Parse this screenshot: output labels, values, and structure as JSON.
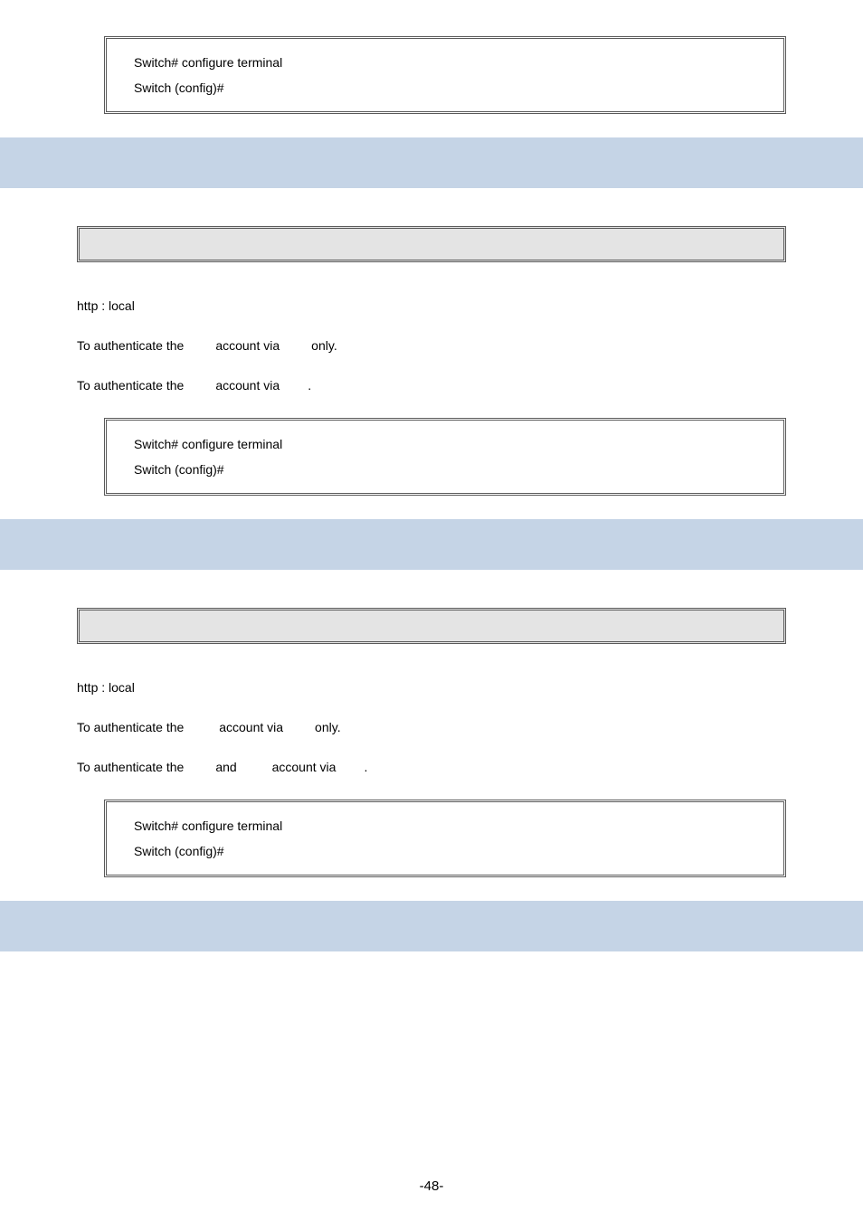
{
  "box1": {
    "line1": "Switch# configure terminal",
    "line2": "Switch (config)#"
  },
  "section1": {
    "default_line": "http : local",
    "line_a_1": "To authenticate the ",
    "line_a_2": " account via ",
    "line_a_3": " only.",
    "line_b_1": "To authenticate the ",
    "line_b_2": " account via ",
    "line_b_3": "."
  },
  "box2": {
    "line1": "Switch# configure terminal",
    "line2": "Switch (config)#"
  },
  "section2": {
    "default_line": "http : local",
    "line_a_1": "To authenticate the ",
    "line_a_2": " account via ",
    "line_a_3": " only.",
    "line_b_1": "To authenticate the ",
    "line_b_2": " and ",
    "line_b_3": " account via ",
    "line_b_4": "."
  },
  "box3": {
    "line1": "Switch# configure terminal",
    "line2": "Switch (config)#"
  },
  "page_number": "-48-"
}
